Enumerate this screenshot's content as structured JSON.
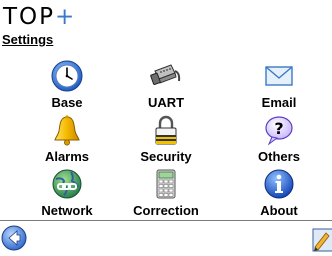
{
  "app": {
    "logo_main": "TOP",
    "logo_plus": "+"
  },
  "page": {
    "title": "Settings"
  },
  "menu": {
    "items": [
      {
        "label": "Base",
        "icon": "clock-icon"
      },
      {
        "label": "UART",
        "icon": "serial-connector-icon"
      },
      {
        "label": "Email",
        "icon": "envelope-icon"
      },
      {
        "label": "Alarms",
        "icon": "bell-icon"
      },
      {
        "label": "Security",
        "icon": "padlock-icon"
      },
      {
        "label": "Others",
        "icon": "question-bubble-icon"
      },
      {
        "label": "Network",
        "icon": "globe-network-icon"
      },
      {
        "label": "Correction",
        "icon": "calculator-icon"
      },
      {
        "label": "About",
        "icon": "info-icon"
      }
    ]
  },
  "bottombar": {
    "back_icon": "back-arrow-icon",
    "tool_icon": "edit-tool-icon"
  },
  "colors": {
    "accent": "#3a78c8",
    "bell": "#f5b800",
    "background": "#ffffff",
    "divider": "#7a7a7a"
  }
}
